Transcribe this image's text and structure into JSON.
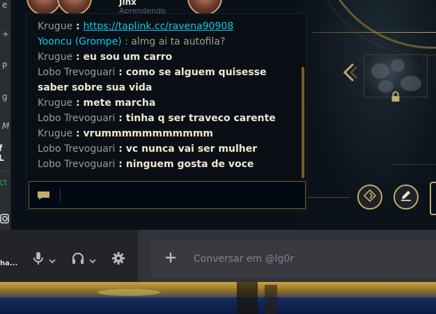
{
  "left_strip": {
    "fragments": [
      "e",
      "+",
      "P",
      "g",
      "M",
      "f L",
      "ct"
    ]
  },
  "top": {
    "player_name": "Jinx",
    "player_sub": "Aprendendo"
  },
  "chat": {
    "messages": [
      {
        "sender": "Krugue",
        "text": "https://taplink.cc/ravena90908",
        "kind": "link",
        "sender_color": "gray"
      },
      {
        "sender": "Yooncu (Grompe)",
        "text": "almg ai ta autofila?",
        "kind": "plain",
        "sender_color": "blue"
      },
      {
        "sender": "Krugue",
        "text": "eu sou um carro",
        "kind": "bold",
        "sender_color": "gray"
      },
      {
        "sender": "Lobo Trevoguari",
        "text": "como se alguem quisesse saber sobre sua vida",
        "kind": "bold",
        "sender_color": "gray"
      },
      {
        "sender": "Krugue",
        "text": "mete marcha",
        "kind": "bold",
        "sender_color": "gray"
      },
      {
        "sender": "Lobo Trevoguari",
        "text": "tinha q ser traveco carente",
        "kind": "bold",
        "sender_color": "gray"
      },
      {
        "sender": "Krugue",
        "text": "vrummmmmmmmmmm",
        "kind": "bold",
        "sender_color": "gray"
      },
      {
        "sender": "Lobo Trevoguari",
        "text": "vc nunca vai ser mulher",
        "kind": "bold",
        "sender_color": "gray"
      },
      {
        "sender": "Lobo Trevoguari",
        "text": "ninguem gosta de voce",
        "kind": "bold",
        "sender_color": "gray"
      }
    ],
    "separator": " : ",
    "input_value": ""
  },
  "discord": {
    "username": "ha...",
    "composer_placeholder": "Conversar em @lg0r"
  },
  "colors": {
    "gold": "#c8aa6e",
    "dark_gold": "#785a28",
    "blue_name": "#0acbe6",
    "chat_text": "#f0e6d2",
    "chat_sender": "#a09b8c"
  },
  "icons": [
    "chevron-left-icon",
    "lock-icon",
    "rune-icon",
    "edit-icon",
    "chat-bubble-icon",
    "microphone-icon",
    "headphones-icon",
    "gear-icon",
    "plus-icon"
  ]
}
